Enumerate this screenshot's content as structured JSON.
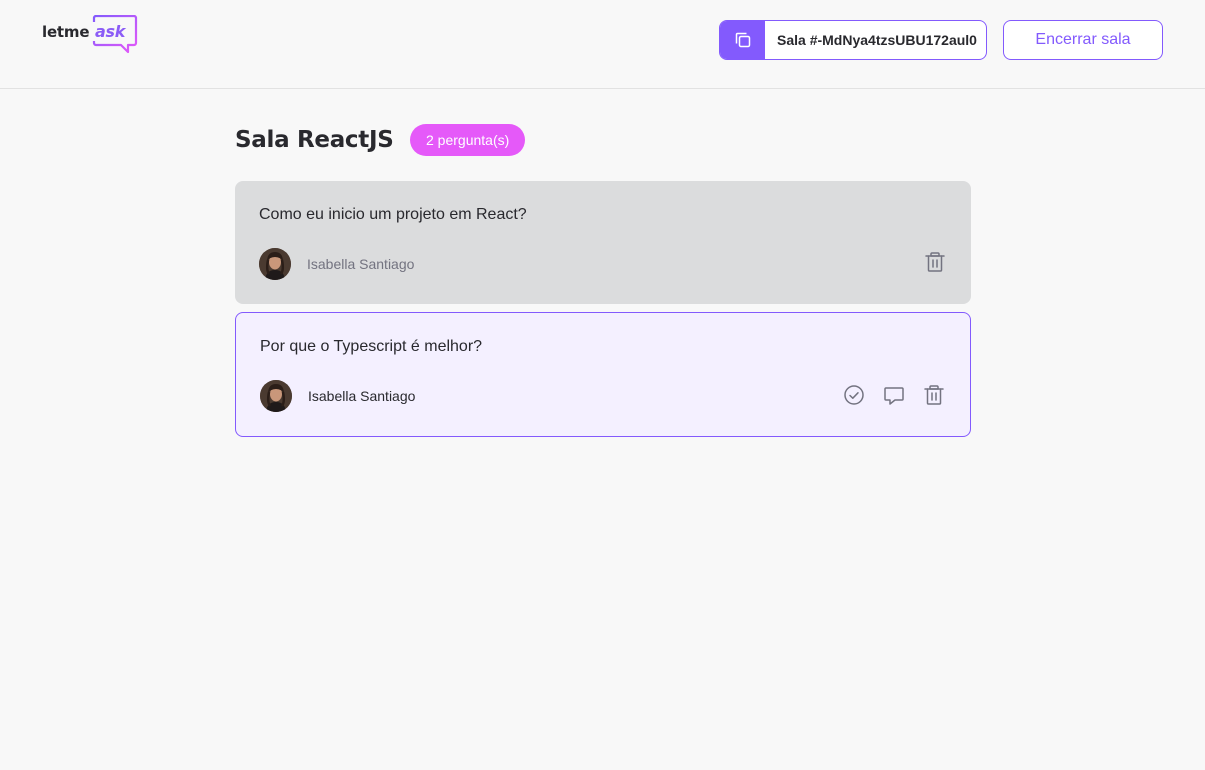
{
  "header": {
    "logo": {
      "letme": "letme",
      "ask": "ask"
    },
    "room_code": {
      "label": "Sala #-MdNya4tzsUBU172aul0",
      "icon": "copy-icon"
    },
    "close_room_label": "Encerrar sala"
  },
  "main": {
    "title": "Sala ReactJS",
    "question_count": "2 pergunta(s)",
    "questions": [
      {
        "content": "Como eu inicio um projeto em React?",
        "author": "Isabella Santiago",
        "state": "answered",
        "actions": [
          "trash-icon"
        ]
      },
      {
        "content": "Por que o Typescript é melhor?",
        "author": "Isabella Santiago",
        "state": "highlighted",
        "actions": [
          "check-circle-icon",
          "comment-icon",
          "trash-icon"
        ]
      }
    ]
  },
  "colors": {
    "primary": "#835afd",
    "pink": "#e559f9",
    "answered_bg": "#dbdcdd",
    "highlighted_bg": "#f4f0ff",
    "background": "#f8f8f8"
  }
}
